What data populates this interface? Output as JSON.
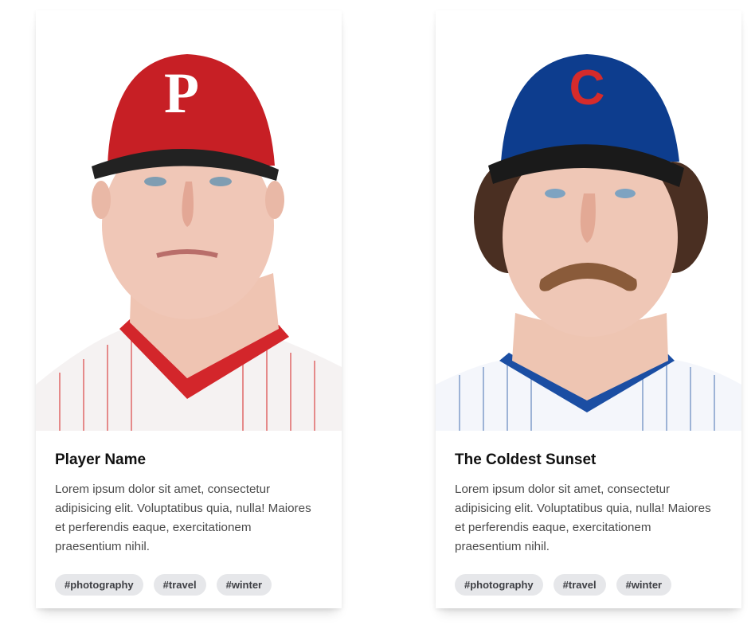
{
  "cards": [
    {
      "title": "Player Name",
      "description": "Lorem ipsum dolor sit amet, consectetur adipisicing elit. Voluptatibus quia, nulla! Maiores et perferendis eaque, exercitationem praesentium nihil.",
      "image": "baseball-player-red-cap-photo",
      "tags": [
        "#photography",
        "#travel",
        "#winter"
      ]
    },
    {
      "title": "The Coldest Sunset",
      "description": "Lorem ipsum dolor sit amet, consectetur adipisicing elit. Voluptatibus quia, nulla! Maiores et perferendis eaque, exercitationem praesentium nihil.",
      "image": "baseball-player-blue-cap-photo",
      "tags": [
        "#photography",
        "#travel",
        "#winter"
      ]
    }
  ],
  "colors": {
    "card_bg": "#ffffff",
    "tag_bg": "#e6e7ea",
    "tag_text": "#3e3f44",
    "title_text": "#111111",
    "desc_text": "#4a4a4a"
  }
}
